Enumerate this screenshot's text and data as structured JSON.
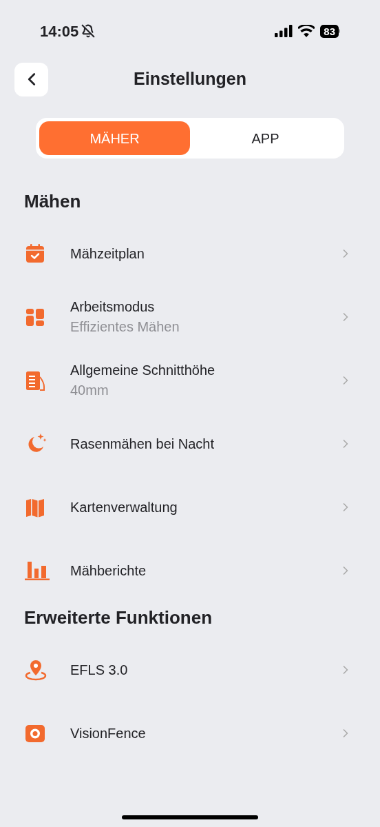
{
  "status_bar": {
    "time": "14:05",
    "battery": "83"
  },
  "header": {
    "title": "Einstellungen"
  },
  "tabs": [
    {
      "label": "MÄHER",
      "selected": true
    },
    {
      "label": "APP",
      "selected": false
    }
  ],
  "sections": [
    {
      "title": "Mähen",
      "items": [
        {
          "label": "Mähzeitplan"
        },
        {
          "label": "Arbeitsmodus",
          "value": "Effizientes Mähen"
        },
        {
          "label": "Allgemeine Schnitthöhe",
          "value": "40mm"
        },
        {
          "label": "Rasenmähen bei Nacht"
        },
        {
          "label": "Kartenverwaltung"
        },
        {
          "label": "Mähberichte"
        }
      ]
    },
    {
      "title": "Erweiterte Funktionen",
      "items": [
        {
          "label": "EFLS 3.0"
        },
        {
          "label": "VisionFence"
        }
      ]
    }
  ]
}
